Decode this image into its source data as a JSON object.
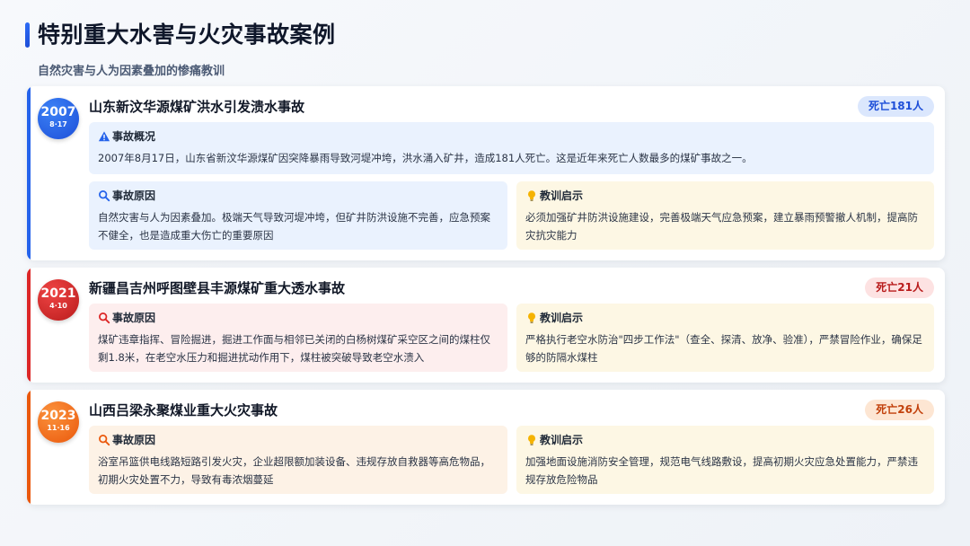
{
  "header": {
    "title": "特别重大水害与火灾事故案例",
    "subtitle": "自然灾害与人为因素叠加的惨痛教训"
  },
  "cases": [
    {
      "year": "2007",
      "date": "8·17",
      "title": "山东新汶华源煤矿洪水引发溃水事故",
      "deaths": "死亡181人",
      "accent": "#2563eb",
      "overview": {
        "label": "事故概况",
        "icon": "warning-icon",
        "text": "2007年8月17日，山东省新汶华源煤矿因突降暴雨导致河堤冲垮，洪水涌入矿井，造成181人死亡。这是近年来死亡人数最多的煤矿事故之一。"
      },
      "cause": {
        "label": "事故原因",
        "icon": "search-icon",
        "text": "自然灾害与人为因素叠加。极端天气导致河堤冲垮，但矿井防洪设施不完善，应急预案不健全，也是造成重大伤亡的重要原因"
      },
      "lesson": {
        "label": "教训启示",
        "icon": "lightbulb-icon",
        "text": "必须加强矿井防洪设施建设，完善极端天气应急预案，建立暴雨预警撤人机制，提高防灾抗灾能力"
      }
    },
    {
      "year": "2021",
      "date": "4·10",
      "title": "新疆昌吉州呼图壁县丰源煤矿重大透水事故",
      "deaths": "死亡21人",
      "accent": "#dc2626",
      "cause": {
        "label": "事故原因",
        "icon": "search-icon",
        "text": "煤矿违章指挥、冒险掘进，掘进工作面与相邻已关闭的白杨树煤矿采空区之间的煤柱仅剩1.8米，在老空水压力和掘进扰动作用下，煤柱被突破导致老空水溃入"
      },
      "lesson": {
        "label": "教训启示",
        "icon": "lightbulb-icon",
        "text": "严格执行老空水防治\"四步工作法\"（查全、探清、放净、验准），严禁冒险作业，确保足够的防隔水煤柱"
      }
    },
    {
      "year": "2023",
      "date": "11·16",
      "title": "山西吕梁永聚煤业重大火灾事故",
      "deaths": "死亡26人",
      "accent": "#ea580c",
      "cause": {
        "label": "事故原因",
        "icon": "search-icon",
        "text": "浴室吊篮供电线路短路引发火灾，企业超限额加装设备、违规存放自救器等高危物品，初期火灾处置不力，导致有毒浓烟蔓延"
      },
      "lesson": {
        "label": "教训启示",
        "icon": "lightbulb-icon",
        "text": "加强地面设施消防安全管理，规范电气线路敷设，提高初期火灾应急处置能力，严禁违规存放危险物品"
      }
    }
  ]
}
